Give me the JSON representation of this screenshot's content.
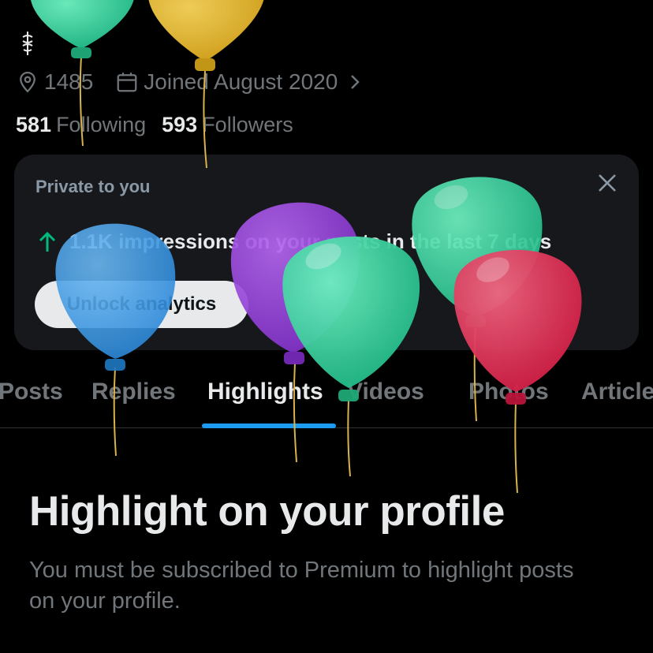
{
  "profile": {
    "bio_icon": "caduceus-icon",
    "location": "1485",
    "joined": "Joined August 2020",
    "following_count": "581",
    "following_label": "Following",
    "followers_count": "593",
    "followers_label": "Followers"
  },
  "analytics_card": {
    "label": "Private to you",
    "stat": "1.1K impressions on your posts in the last 7 days",
    "button": "Unlock analytics",
    "stat_icon": "arrow-up-icon",
    "close_icon": "close-icon"
  },
  "tabs": [
    {
      "label": "Posts",
      "active": false
    },
    {
      "label": "Replies",
      "active": false
    },
    {
      "label": "Highlights",
      "active": true
    },
    {
      "label": "Videos",
      "active": false
    },
    {
      "label": "Photos",
      "active": false
    },
    {
      "label": "Articles",
      "active": false
    }
  ],
  "main": {
    "title": "Highlight on your profile",
    "description": "You must be subscribed to Premium to highlight posts on your profile."
  },
  "colors": {
    "background": "#000000",
    "accent": "#1d9bf0",
    "arrow_green": "#00ba7c",
    "balloon_green": "#2fd39b",
    "balloon_gold": "#e4b62a",
    "balloon_purple": "#9a3fd9",
    "balloon_blue": "#3b9ce8",
    "balloon_red": "#e2294f"
  }
}
